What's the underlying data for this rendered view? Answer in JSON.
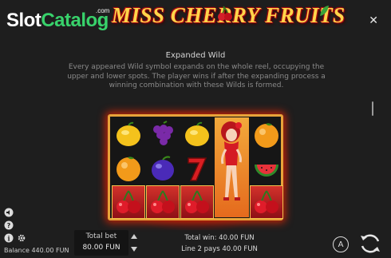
{
  "header": {
    "brand_part1": "Slot",
    "brand_part2": "Catalog",
    "brand_suffix": ".com",
    "game_logo": "MISS CHERRY FRUITS",
    "close_label": "✕"
  },
  "rules": {
    "title": "Expanded Wild",
    "description": "Every appeared Wild symbol expands on the whole reel, occupying the upper and lower spots. The player wins if after the expanding process a winning combination with these Wilds is formed."
  },
  "reels": {
    "columns": [
      [
        "lemon",
        "orange",
        "cherry"
      ],
      [
        "grapes",
        "plum",
        "cherry"
      ],
      [
        "lemon",
        "seven",
        "cherry"
      ],
      [
        "wild",
        "wild",
        "wild"
      ],
      [
        "orange",
        "watermelon",
        "cherry"
      ]
    ]
  },
  "footer": {
    "balance_label": "Balance",
    "balance_value": "440.00 FUN",
    "total_bet_label": "Total bet",
    "total_bet_value": "80.00 FUN",
    "total_win_label": "Total win:",
    "total_win_value": "40.00 FUN",
    "line_pays_label": "Line 2 pays",
    "line_pays_value": "40.00 FUN",
    "autoplay_label": "A"
  },
  "colors": {
    "accent_green": "#38d26b",
    "frame_gold": "#e8a33a",
    "background": "#1e1e1e"
  }
}
